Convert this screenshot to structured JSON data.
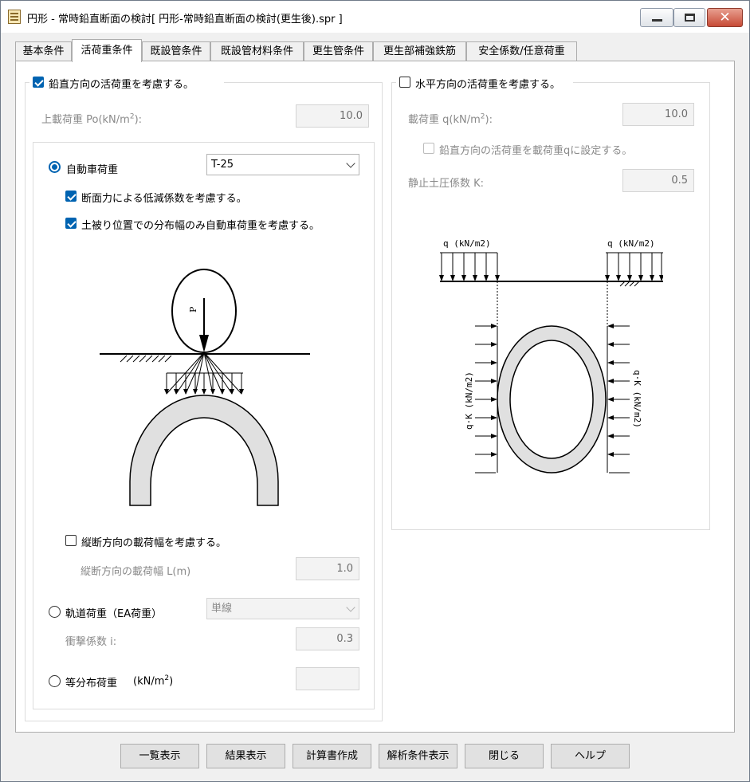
{
  "window": {
    "title": "円形 - 常時鉛直断面の検討[ 円形-常時鉛直断面の検討(更生後).spr ]"
  },
  "tabs": [
    {
      "label": "基本条件"
    },
    {
      "label": "活荷重条件"
    },
    {
      "label": "既設管条件"
    },
    {
      "label": "既設管材料条件"
    },
    {
      "label": "更生管条件"
    },
    {
      "label": "更生部補強鉄筋"
    },
    {
      "label": "安全係数/任意荷重"
    }
  ],
  "vertical": {
    "label": "鉛直方向の活荷重を考慮する。",
    "checked": true,
    "surcharge_label": "上載荷重 Po(kN/m",
    "surcharge_sup": "2",
    "surcharge_suffix": "):",
    "surcharge_value": "10.0",
    "vehicle": {
      "label": "自動車荷重",
      "selected": true,
      "option": "T-25",
      "reduce_label": "断面力による低減係数を考慮する。",
      "reduce_checked": true,
      "cover_label": "土被り位置での分布幅のみ自動車荷重を考慮する。",
      "cover_checked": true,
      "diagram_label": "P"
    },
    "longitudinal": {
      "label": "縦断方向の載荷幅を考慮する。",
      "checked": false,
      "width_label": "縦断方向の載荷幅 L(m)",
      "width_value": "1.0"
    },
    "rail": {
      "label": "軌道荷重（EA荷重）",
      "selected": false,
      "option": "単線",
      "impact_label": "衝撃係数 i:",
      "impact_value": "0.3"
    },
    "uniform": {
      "label": "等分布荷重",
      "unit_prefix": "(kN/m",
      "unit_sup": "2",
      "unit_suffix": ")",
      "selected": false,
      "value": ""
    }
  },
  "horizontal": {
    "label": "水平方向の活荷重を考慮する。",
    "checked": false,
    "load_label": "載荷重 q(kN/m",
    "load_sup": "2",
    "load_suffix": "):",
    "load_value": "10.0",
    "set_label": "鉛直方向の活荷重を載荷重qに設定する。",
    "set_checked": false,
    "k_label": "静止土圧係数 K:",
    "k_value": "0.5",
    "diagram_q_left": "q (kN/m2)",
    "diagram_q_right": "q (kN/m2)",
    "diagram_qk_left": "q·K (kN/m2)",
    "diagram_qk_right": "q·K (kN/m2)"
  },
  "buttons": {
    "list": "一覧表示",
    "result": "結果表示",
    "report": "計算書作成",
    "conditions": "解析条件表示",
    "close": "閉じる",
    "help": "ヘルプ"
  },
  "icons": {
    "app": "app-icon",
    "minimize": "minimize-icon",
    "maximize": "maximize-icon",
    "close": "close-icon",
    "dropdown": "chevron-down-icon"
  }
}
